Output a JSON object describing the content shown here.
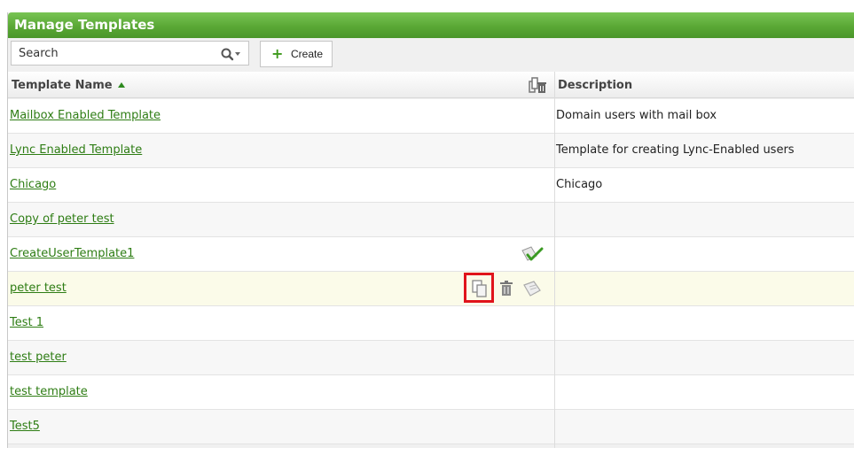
{
  "header": {
    "title": "Manage Templates"
  },
  "toolbar": {
    "search_placeholder": "Search",
    "create_label": "Create"
  },
  "table": {
    "columns": {
      "name": "Template Name",
      "description": "Description"
    },
    "rows": [
      {
        "name": "Mailbox Enabled Template",
        "description": "Domain users with mail box"
      },
      {
        "name": "Lync Enabled Template",
        "description": "Template for creating Lync-Enabled users"
      },
      {
        "name": "Chicago",
        "description": "Chicago"
      },
      {
        "name": "Copy of peter test",
        "description": ""
      },
      {
        "name": "CreateUserTemplate1",
        "description": ""
      },
      {
        "name": "peter test",
        "description": ""
      },
      {
        "name": "Test 1",
        "description": ""
      },
      {
        "name": "test peter",
        "description": ""
      },
      {
        "name": "test template",
        "description": ""
      },
      {
        "name": "Test5",
        "description": ""
      }
    ]
  },
  "icons": {
    "search": "search-icon",
    "create": "plus-icon",
    "column_settings": "column-settings-icon",
    "default_template": "default-check-icon",
    "copy": "copy-icon",
    "delete": "trash-icon",
    "set_default": "set-default-icon"
  },
  "colors": {
    "header_green": "#5aa835",
    "link_green": "#2e7d14",
    "highlight_box": "#e0141b",
    "highlight_row": "#fbfbe9"
  }
}
